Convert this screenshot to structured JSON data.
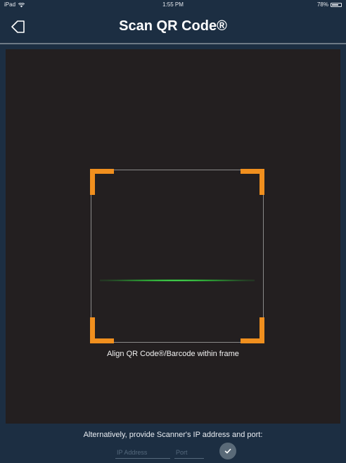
{
  "status_bar": {
    "device": "iPad",
    "time": "1:55 PM",
    "battery": "78%",
    "battery_level": 0.78,
    "wifi_icon": "wifi-icon"
  },
  "header": {
    "title": "Scan QR Code®",
    "back_icon": "back-arrow-icon"
  },
  "scanner": {
    "hint": "Align QR Code®/Barcode within frame",
    "corner_color": "#f08f1e",
    "scanline_color": "#3ddc4a"
  },
  "manual_entry": {
    "prompt": "Alternatively, provide Scanner's IP address and port:",
    "ip_placeholder": "IP Address",
    "ip_value": "",
    "port_placeholder": "Port",
    "port_value": "",
    "confirm_icon": "checkmark-icon"
  },
  "colors": {
    "background": "#1c2e42",
    "camera_view": "#231f20",
    "accent": "#f08f1e"
  }
}
